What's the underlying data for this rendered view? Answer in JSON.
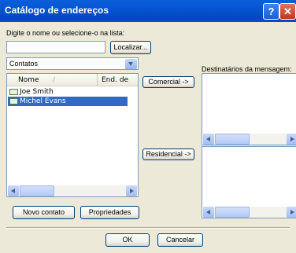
{
  "window": {
    "title": "Catálogo de endereços",
    "help_glyph": "?",
    "close_glyph": "✕"
  },
  "search": {
    "label": "Digite o nome ou selecione-o na lista:",
    "value": "",
    "find_button": "Localizar..."
  },
  "source_combo": {
    "value": "Contatos"
  },
  "contacts": {
    "columns": [
      "Nome",
      "End. de"
    ],
    "sort_glyph": "/",
    "rows": [
      {
        "name": "Joe Smith",
        "selected": false
      },
      {
        "name": "Michel Evans",
        "selected": true
      }
    ]
  },
  "actions": {
    "business": "Comercial ->",
    "home": "Residencial ->"
  },
  "recipients": {
    "label": "Destinatários da mensagem:"
  },
  "bottom_buttons": {
    "new_contact": "Novo contato",
    "properties": "Propriedades"
  },
  "dialog_buttons": {
    "ok": "OK",
    "cancel": "Cancelar"
  }
}
